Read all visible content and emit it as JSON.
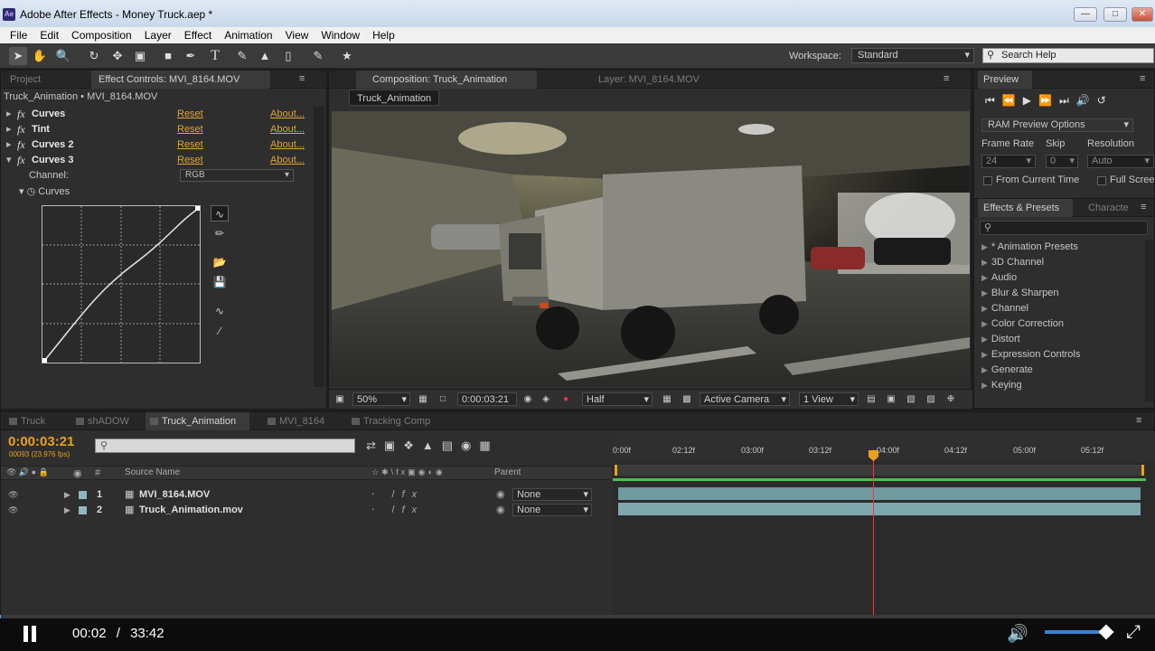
{
  "window": {
    "title": "Adobe After Effects - Money Truck.aep *",
    "app_badge": "Ae"
  },
  "menu": [
    "File",
    "Edit",
    "Composition",
    "Layer",
    "Effect",
    "Animation",
    "View",
    "Window",
    "Help"
  ],
  "toolbar": {
    "workspace_label": "Workspace:",
    "workspace_value": "Standard",
    "search_placeholder": "Search Help"
  },
  "effect_controls": {
    "tabs": {
      "project": "Project",
      "effect_controls": "Effect Controls: MVI_8164.MOV"
    },
    "breadcrumb": "Truck_Animation • MVI_8164.MOV",
    "effects": [
      {
        "name": "Curves",
        "reset": "Reset",
        "about": "About..."
      },
      {
        "name": "Tint",
        "reset": "Reset",
        "about": "About..."
      },
      {
        "name": "Curves 2",
        "reset": "Reset",
        "about": "About..."
      },
      {
        "name": "Curves 3",
        "reset": "Reset",
        "about": "About..."
      }
    ],
    "fx_glyph": "fx",
    "channel_label": "Channel:",
    "channel_value": "RGB",
    "curves_label": "Curves"
  },
  "composition": {
    "tabs": {
      "composition": "Composition: Truck_Animation",
      "layer": "Layer: MVI_8164.MOV"
    },
    "comp_label": "Truck_Animation",
    "zoom": "50%",
    "timecode": "0:00:03:21",
    "resolution": "Half",
    "camera": "Active Camera",
    "views": "1 View"
  },
  "preview": {
    "tab": "Preview",
    "ram_options": "RAM Preview Options",
    "frame_rate_label": "Frame Rate",
    "skip_label": "Skip",
    "resolution_label": "Resolution",
    "frame_rate_value": "24",
    "skip_value": "0",
    "resolution_value": "Auto",
    "from_current_time": "From Current Time",
    "full_screen": "Full Screen"
  },
  "effects_presets": {
    "tabs": {
      "effects": "Effects & Presets",
      "character": "Characte"
    },
    "items": [
      "* Animation Presets",
      "3D Channel",
      "Audio",
      "Blur & Sharpen",
      "Channel",
      "Color Correction",
      "Distort",
      "Expression Controls",
      "Generate",
      "Keying"
    ]
  },
  "timeline": {
    "tabs": [
      "Truck",
      "shADOW",
      "Truck_Animation",
      "MVI_8164",
      "Tracking Comp"
    ],
    "timecode": "0:00:03:21",
    "frames_fps": "00093 (23.976 fps)",
    "columns": {
      "source_name": "Source Name",
      "parent": "Parent"
    },
    "ruler": [
      "0:00f",
      "02:12f",
      "03:00f",
      "03:12f",
      "04:00f",
      "04:12f",
      "05:00f",
      "05:12f"
    ],
    "layers": [
      {
        "num": "1",
        "name": "MVI_8164.MOV",
        "parent": "None"
      },
      {
        "num": "2",
        "name": "Truck_Animation.mov",
        "parent": "None"
      }
    ]
  },
  "player": {
    "current": "00:02",
    "separator": "/",
    "total": "33:42",
    "progress": 0.001,
    "volume": 0.9
  }
}
